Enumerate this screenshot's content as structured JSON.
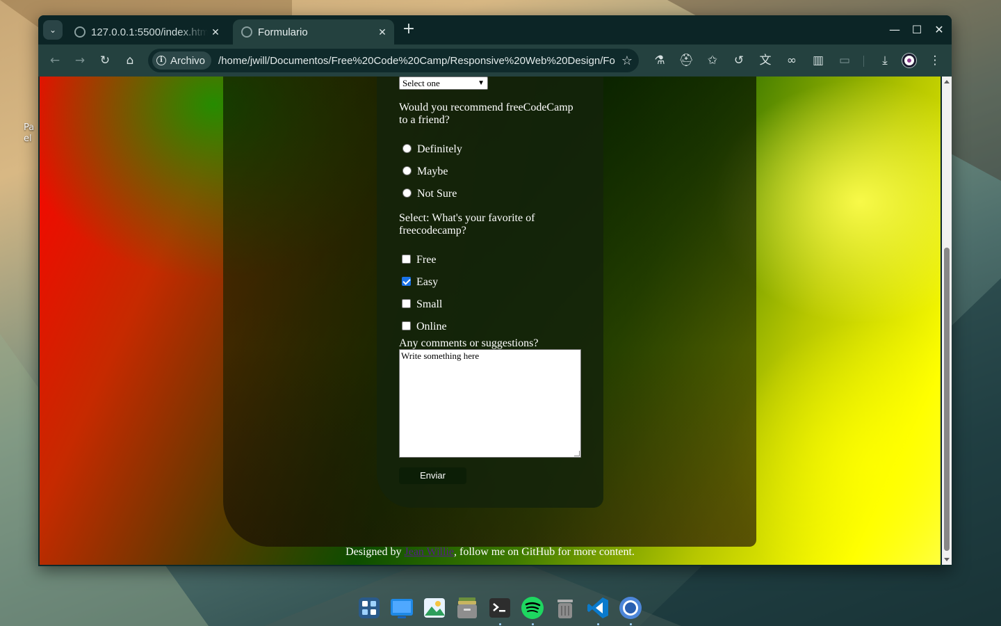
{
  "desktop": {
    "label_fragment": "Pa el"
  },
  "browser": {
    "tabs": [
      {
        "title": "127.0.0.1:5500/index.htm",
        "active": false
      },
      {
        "title": "Formulario",
        "active": true
      }
    ],
    "security_chip": "Archivo",
    "url": "/home/jwill/Documentos/Free%20Code%20Camp/Responsive%20Web%20Design/For...",
    "icons": {
      "tab_menu": "chevron-down-icon",
      "tab_close": "close-icon",
      "new_tab": "plus-icon",
      "minimize": "minimize-icon",
      "maximize": "maximize-icon",
      "close_window": "close-icon",
      "back": "arrow-left-icon",
      "forward": "arrow-right-icon",
      "reload": "reload-icon",
      "home": "home-icon",
      "bookmark": "star-icon",
      "labs": "flask-icon",
      "incognito": "incognito-icon",
      "bookmarks_star": "star-plus-icon",
      "history": "history-icon",
      "translate": "translate-icon",
      "link": "link-icon",
      "side_panel": "side-panel-icon",
      "devices": "devices-icon",
      "download": "download-icon",
      "menu": "kebab-menu-icon"
    },
    "glyphs": {
      "tab_menu": "⌄",
      "tab_close": "✕",
      "new_tab": "+",
      "minimize": "—",
      "maximize": "☐",
      "close_window": "✕",
      "back": "←",
      "forward": "→",
      "reload": "↻",
      "home": "⌂",
      "bookmark": "☆",
      "labs": "⚗",
      "incognito": "⛑",
      "bookmarks_star": "✩",
      "history": "↺",
      "translate": "文",
      "link": "∞",
      "side_panel": "▥",
      "devices": "▭",
      "download": "⤓",
      "menu": "⋮"
    }
  },
  "form": {
    "select_value": "Select one",
    "recommend_question": "Would you recommend freeCodeCamp to a friend?",
    "radio_options": [
      "Definitely",
      "Maybe",
      "Not Sure"
    ],
    "favorite_question": "Select: What's your favorite of freecodecamp?",
    "checkbox_options": [
      {
        "label": "Free",
        "checked": false
      },
      {
        "label": "Easy",
        "checked": true
      },
      {
        "label": "Small",
        "checked": false
      },
      {
        "label": "Online",
        "checked": false
      }
    ],
    "comments_label": "Any comments or suggestions?",
    "comments_value": "Write something here",
    "submit_label": "Enviar"
  },
  "footer": {
    "prefix": "Designed by ",
    "author_link": "Jean Willie",
    "suffix": ", follow me on GitHub for more content."
  },
  "colors": {
    "checkbox_accent": "#1a73e8",
    "link_visited": "#551a8b",
    "browser_frame": "#0c2526",
    "toolbar": "#24413f"
  },
  "dock": {
    "items": [
      "apps-grid-icon",
      "desktop-icon",
      "image-viewer-icon",
      "files-icon",
      "terminal-icon",
      "spotify-icon",
      "trash-icon",
      "vscode-icon",
      "chrome-icon"
    ]
  }
}
